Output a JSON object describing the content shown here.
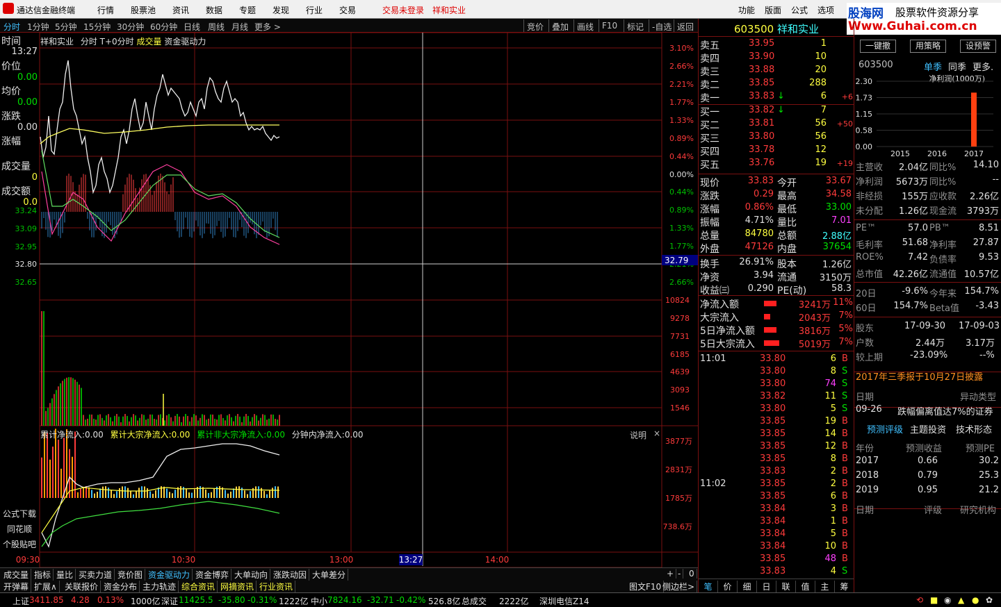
{
  "app": {
    "title": "通达信金融终端",
    "menus": [
      "行情",
      "股票池",
      "资讯",
      "数据",
      "专题",
      "发现",
      "行业",
      "交易"
    ],
    "login_status": "交易未登录",
    "stock_title": "祥和实业",
    "right_menus": [
      "功能",
      "版面",
      "公式",
      "选项"
    ],
    "watermark1": "股海网",
    "watermark2": "股票软件资源分享",
    "watermark3": "Www.Guhai.com.cn"
  },
  "periods": [
    "分时",
    "1分钟",
    "5分钟",
    "15分钟",
    "30分钟",
    "60分钟",
    "日线",
    "周线",
    "月线",
    "更多 >"
  ],
  "toolbar": [
    "竞价",
    "叠加",
    "画线",
    "F10",
    "标记",
    "-自选",
    "返回"
  ],
  "chart": {
    "header": {
      "name": "祥和实业",
      "mode": "分时 T+0分时",
      "vol": "成交量",
      "ind": "资金驱动力"
    },
    "left_labels": {
      "time_label": "时间",
      "time": "13:27",
      "price_label": "价位",
      "price": "0.00",
      "avg_label": "均价",
      "avg": "0.00",
      "chg_label": "涨跌",
      "chg": "0.00",
      "pct_label": "涨幅",
      "vol_label": "成交量",
      "vol": "0",
      "amt_label": "成交额",
      "amt": "0.0"
    },
    "price_ticks_left": [
      "33.24",
      "33.09",
      "32.95",
      "32.80",
      "32.65"
    ],
    "pct_ticks_right": [
      "3.10%",
      "2.66%",
      "2.21%",
      "1.77%",
      "1.33%",
      "0.89%",
      "0.44%",
      "0.00%",
      "0.44%",
      "0.89%",
      "1.33%",
      "1.77%",
      "2.21%",
      "2.66%"
    ],
    "current_tag": "32.79",
    "vol_ticks": [
      "10824",
      "9278",
      "7731",
      "6185",
      "4639",
      "3093",
      "1546"
    ],
    "flow_header": {
      "a": "累计净流入:0.00",
      "b": "累计大宗净流入:0.00",
      "c": "累计非大宗净流入:0.00",
      "d": "分钟内净流入:0.00",
      "help": "说明"
    },
    "flow_ticks": [
      "3877万",
      "2831万",
      "1785万",
      "738.6万"
    ],
    "side_links": [
      "公式下载",
      "同花顺",
      "个股贴吧"
    ],
    "time_axis": [
      "09:30",
      "10:30",
      "13:00",
      "13:27",
      "14:00"
    ]
  },
  "quote": {
    "code": "603500",
    "name": "祥和实业",
    "asks": [
      {
        "label": "卖五",
        "price": "33.95",
        "vol": "1",
        "chg": ""
      },
      {
        "label": "卖四",
        "price": "33.90",
        "vol": "10",
        "chg": ""
      },
      {
        "label": "卖三",
        "price": "33.88",
        "vol": "20",
        "chg": ""
      },
      {
        "label": "卖二",
        "price": "33.85",
        "vol": "288",
        "chg": ""
      },
      {
        "label": "卖一",
        "price": "33.83",
        "vol": "6",
        "chg": "+6"
      }
    ],
    "bids": [
      {
        "label": "买一",
        "price": "33.82",
        "vol": "7",
        "chg": ""
      },
      {
        "label": "买二",
        "price": "33.81",
        "vol": "56",
        "chg": "+50"
      },
      {
        "label": "买三",
        "price": "33.80",
        "vol": "56",
        "chg": ""
      },
      {
        "label": "买四",
        "price": "33.78",
        "vol": "12",
        "chg": ""
      },
      {
        "label": "买五",
        "price": "33.76",
        "vol": "19",
        "chg": "+19"
      }
    ],
    "stats": [
      {
        "l1": "现价",
        "v1": "33.83",
        "l2": "今开",
        "v2": "33.67"
      },
      {
        "l1": "涨跌",
        "v1": "0.29",
        "l2": "最高",
        "v2": "34.58"
      },
      {
        "l1": "涨幅",
        "v1": "0.86%",
        "l2": "最低",
        "v2": "33.00"
      },
      {
        "l1": "振幅",
        "v1": "4.71%",
        "l2": "量比",
        "v2": "7.01"
      },
      {
        "l1": "总量",
        "v1": "84780",
        "l2": "总额",
        "v2": "2.88亿"
      },
      {
        "l1": "外盘",
        "v1": "47126",
        "l2": "内盘",
        "v2": "37654"
      }
    ],
    "stats2": [
      {
        "l1": "换手",
        "v1": "26.91%",
        "l2": "股本",
        "v2": "1.26亿"
      },
      {
        "l1": "净资",
        "v1": "3.94",
        "l2": "流通",
        "v2": "3150万"
      },
      {
        "l1": "收益㈢",
        "v1": "0.290",
        "l2": "PE(动)",
        "v2": "58.3"
      }
    ],
    "flows": [
      {
        "l": "净流入额",
        "v": "3241万",
        "p": "11%",
        "fill": 0.8
      },
      {
        "l": "大宗流入",
        "v": "2043万",
        "p": "7%",
        "fill": 0.4
      },
      {
        "l": "5日净流入额",
        "v": "3816万",
        "p": "5%",
        "fill": 0.8
      },
      {
        "l": "5日大宗流入",
        "v": "5019万",
        "p": "7%",
        "fill": 1.0
      }
    ],
    "ticks": [
      {
        "t": "11:01",
        "p": "33.80",
        "v": "6",
        "s": "B"
      },
      {
        "t": "",
        "p": "33.80",
        "v": "8",
        "s": "S"
      },
      {
        "t": "",
        "p": "33.80",
        "v": "74",
        "s": "S"
      },
      {
        "t": "",
        "p": "33.82",
        "v": "11",
        "s": "S"
      },
      {
        "t": "",
        "p": "33.80",
        "v": "5",
        "s": "S"
      },
      {
        "t": "",
        "p": "33.85",
        "v": "19",
        "s": "B"
      },
      {
        "t": "",
        "p": "33.85",
        "v": "14",
        "s": "B"
      },
      {
        "t": "",
        "p": "33.85",
        "v": "12",
        "s": "B"
      },
      {
        "t": "",
        "p": "33.85",
        "v": "8",
        "s": "B"
      },
      {
        "t": "",
        "p": "33.83",
        "v": "2",
        "s": "B"
      },
      {
        "t": "11:02",
        "p": "33.85",
        "v": "2",
        "s": "B"
      },
      {
        "t": "",
        "p": "33.85",
        "v": "6",
        "s": "B"
      },
      {
        "t": "",
        "p": "33.84",
        "v": "3",
        "s": "B"
      },
      {
        "t": "",
        "p": "33.84",
        "v": "1",
        "s": "B"
      },
      {
        "t": "",
        "p": "33.84",
        "v": "5",
        "s": "B"
      },
      {
        "t": "",
        "p": "33.84",
        "v": "10",
        "s": "B"
      },
      {
        "t": "",
        "p": "33.85",
        "v": "48",
        "s": "B"
      },
      {
        "t": "",
        "p": "33.83",
        "v": "4",
        "s": "S"
      }
    ],
    "bottom_tabs": [
      "笔",
      "价",
      "细",
      "日",
      "联",
      "值",
      "主",
      "筹"
    ]
  },
  "fund": {
    "buttons": [
      "一键撤",
      "用策略",
      "设预警"
    ],
    "code": "603500",
    "tabs": [
      "单季",
      "同季",
      "更多."
    ],
    "chart_label": "净利润(1000万)",
    "chart_data": {
      "type": "bar",
      "categories": [
        "2015",
        "2016",
        "2017"
      ],
      "values": [
        0,
        0,
        1.9
      ],
      "title": "净利润(1000万)",
      "yticks": [
        "2.30",
        "1.73",
        "1.15",
        "0.58",
        "0.00"
      ],
      "ylim": [
        0,
        2.3
      ]
    },
    "rows1": [
      {
        "l1": "主营收",
        "v1": "2.04亿",
        "l2": "同比%",
        "v2": "14.10"
      },
      {
        "l1": "净利润",
        "v1": "5673万",
        "l2": "同比%",
        "v2": "--"
      },
      {
        "l1": "非经损",
        "v1": "155万",
        "l2": "应收款",
        "v2": "2.26亿"
      },
      {
        "l1": "未分配",
        "v1": "1.26亿",
        "l2": "现金流",
        "v2": "3793万"
      }
    ],
    "rows2": [
      {
        "l1": "PE™",
        "v1": "57.0",
        "l2": "PB™",
        "v2": "8.51"
      },
      {
        "l1": "毛利率",
        "v1": "51.68",
        "l2": "净利率",
        "v2": "27.87"
      },
      {
        "l1": "ROE%",
        "v1": "7.42",
        "l2": "负债率",
        "v2": "9.53"
      },
      {
        "l1": "总市值",
        "v1": "42.26亿",
        "l2": "流通值",
        "v2": "10.57亿"
      }
    ],
    "rows3": [
      {
        "l1": "20日",
        "v1": "-9.6%",
        "l2": "今年来",
        "v2": "154.7%"
      },
      {
        "l1": "60日",
        "v1": "154.7%",
        "l2": "Beta值",
        "v2": "-3.43"
      }
    ],
    "holders": {
      "l": "股东",
      "d1": "17-09-30",
      "d2": "17-09-03",
      "r1": "户数",
      "v1": "2.44万",
      "v2": "3.17万",
      "r2": "较上期",
      "w1": "-23.09%",
      "w2": "--%"
    },
    "notice": "2017年三季报于10月27日披露",
    "anomaly": {
      "h1": "日期",
      "h2": "异动类型",
      "d": "09-26",
      "t": "跌幅偏离值达7%的证券"
    },
    "forecast_tabs": [
      "预测评级",
      "主题投资",
      "技术形态"
    ],
    "forecast_head": [
      "年份",
      "预测收益",
      "预测PE"
    ],
    "forecast": [
      {
        "y": "2017",
        "e": "0.66",
        "pe": "30.2"
      },
      {
        "y": "2018",
        "e": "0.79",
        "pe": "25.3"
      },
      {
        "y": "2019",
        "e": "0.95",
        "pe": "21.2"
      }
    ],
    "rating_head": [
      "日期",
      "评级",
      "研究机构"
    ]
  },
  "bottom": {
    "row1": [
      "成交量",
      "指标",
      "量比",
      "买卖力道",
      "竞价图",
      "资金驱动力",
      "资金博弈",
      "大单动向",
      "涨跌动因",
      "大单差分"
    ],
    "row2": [
      "开弹幕",
      "扩展∧",
      "关联报价",
      "资金分布",
      "主力轨迹",
      "综合资讯",
      "网摘资讯",
      "行业资讯"
    ],
    "right": [
      "图文F10",
      "侧边栏>"
    ]
  },
  "status": {
    "sh_label": "上证",
    "sh": "3411.85",
    "sh_chg": "4.28",
    "sh_pct": "0.13%",
    "sh_amt": "1000亿",
    "sz_label": "深证",
    "sz": "11425.5",
    "sz_chg": "-35.80",
    "sz_pct": "-0.31%",
    "sz_amt": "1222亿",
    "zx_label": "中小",
    "zx": "7824.16",
    "zx_chg": "-32.71",
    "zx_pct": "-0.42%",
    "zx_amt": "526.8亿",
    "total_label": "总成交",
    "total": "2222亿",
    "server": "深圳电信Z14"
  },
  "colors": {
    "up": "#ff3b3b",
    "down": "#00e000",
    "grid": "#7a1010",
    "yellow": "#ffff40"
  }
}
